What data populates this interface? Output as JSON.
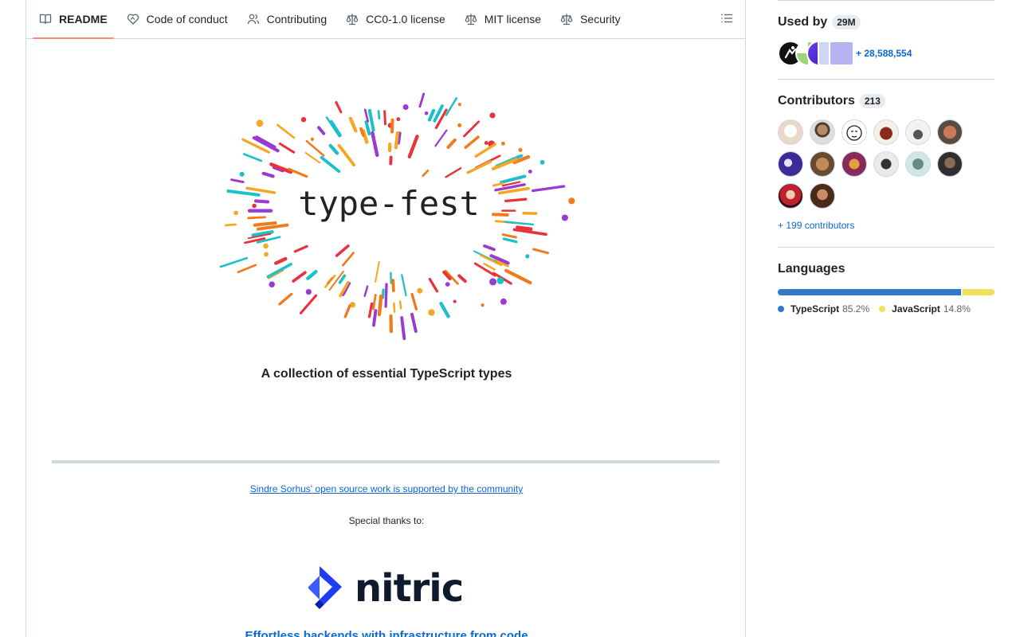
{
  "tabs": [
    {
      "label": "README",
      "icon": "book-icon",
      "active": true
    },
    {
      "label": "Code of conduct",
      "icon": "heart-handshake-icon"
    },
    {
      "label": "Contributing",
      "icon": "people-icon"
    },
    {
      "label": "CC0-1.0 license",
      "icon": "law-icon"
    },
    {
      "label": "MIT license",
      "icon": "law-icon"
    },
    {
      "label": "Security",
      "icon": "law-icon"
    }
  ],
  "readme": {
    "logo_text": "type-fest",
    "tagline": "A collection of essential TypeScript types",
    "support_link": "Sindre Sorhus' open source work is supported by the community",
    "special_thanks": "Special thanks to:",
    "sponsor_name": "nitric",
    "sponsor_tagline": "Effortless backends with infrastructure from code"
  },
  "sidebar": {
    "used_by": {
      "title": "Used by",
      "count": "29M",
      "more": "+ 28,588,554"
    },
    "contributors": {
      "title": "Contributors",
      "count": "213",
      "more": "+ 199 contributors"
    },
    "languages": {
      "title": "Languages",
      "items": [
        {
          "name": "TypeScript",
          "percent": "85.2%",
          "fraction": 0.852,
          "color": "#3178c6"
        },
        {
          "name": "JavaScript",
          "percent": "14.8%",
          "fraction": 0.148,
          "color": "#f1e05a"
        }
      ]
    }
  },
  "colors": {
    "accent": "#0969da",
    "tab_underline": "#fd8c73",
    "border": "#d1d9e0"
  }
}
